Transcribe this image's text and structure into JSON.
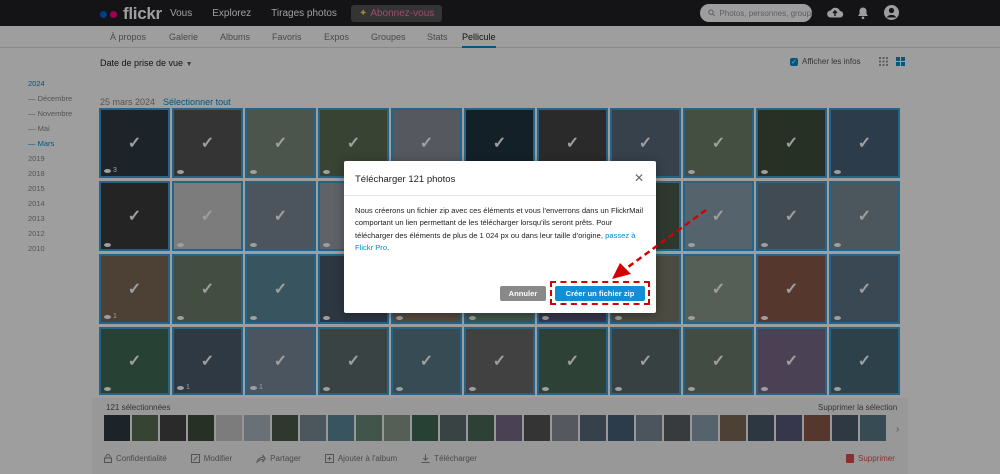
{
  "topbar": {
    "logo_text": "flickr",
    "nav": [
      "Vous",
      "Explorez",
      "Tirages photos"
    ],
    "upgrade_label": "Abonnez-vous",
    "upgrade_icon": "sparkle-icon",
    "search_placeholder": "Photos, personnes, groupes",
    "icons": [
      "upload-cloud-icon",
      "bell-icon",
      "user-avatar-icon"
    ]
  },
  "subnav": {
    "items": [
      "À propos",
      "Galerie",
      "Albums",
      "Favoris",
      "Expos",
      "Groupes",
      "Stats",
      "Pellicule"
    ],
    "active": "Pellicule"
  },
  "toolbar": {
    "sort_label": "Date de prise de vue",
    "show_info_label": "Afficher les infos"
  },
  "sidebar": {
    "items": [
      "2024",
      "— Décembre",
      "— Novembre",
      "— Mai",
      "— Mars",
      "2019",
      "2018",
      "2015",
      "2014",
      "2013",
      "2012",
      "2010"
    ]
  },
  "content": {
    "date_heading": "25 mars 2024",
    "select_all": "Sélectionner tout",
    "views": {
      "r1c1": "3",
      "r3c1": "1",
      "r4c2": "1",
      "r4c3": "1"
    }
  },
  "modal": {
    "title": "Télécharger 121 photos",
    "body": "Nous créerons un fichier zip avec ces éléments et vous l'enverrons dans un FlickrMail comportant un lien permettant de les télécharger lorsqu'ils seront prêts. Pour télécharger des éléments de plus de 1 024 px ou dans leur taille d'origine,",
    "link": "passez à Flickr Pro",
    "body_end": ".",
    "cancel": "Annuler",
    "confirm": "Créer un fichier zip"
  },
  "selection_bar": {
    "count": "121 sélectionnées",
    "clear": "Supprimer la sélection",
    "actions": [
      "Confidentialité",
      "Modifier",
      "Partager",
      "Ajouter à l'album",
      "Télécharger"
    ],
    "delete": "Supprimer"
  },
  "colors": {
    "accent": "#008ecd",
    "selection_border": "#3aa2dc",
    "annotation_red": "#d40000"
  }
}
